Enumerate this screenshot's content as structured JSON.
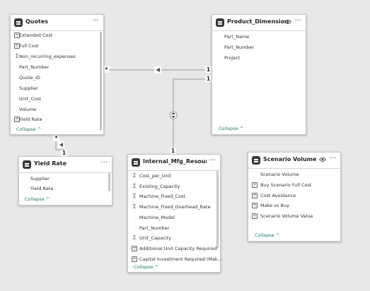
{
  "quotes": {
    "title": "Quotes",
    "fields": [
      {
        "label": "Extended Cost",
        "icon": "calculator-icon"
      },
      {
        "label": "Full Cost",
        "icon": "calculator-icon"
      },
      {
        "label": "Non_recurring_expenses",
        "icon": "sigma-icon"
      },
      {
        "label": "Part_Number",
        "icon": ""
      },
      {
        "label": "Quote_ID",
        "icon": ""
      },
      {
        "label": "Supplier",
        "icon": ""
      },
      {
        "label": "Unit_Cost",
        "icon": ""
      },
      {
        "label": "Volume",
        "icon": ""
      },
      {
        "label": "Yield Rate",
        "icon": "calculator-icon"
      }
    ],
    "collapse": "Collapse ^"
  },
  "product_dimension": {
    "title": "Product_Dimension",
    "fields": [
      {
        "label": "Part_Name"
      },
      {
        "label": "Part_Number"
      },
      {
        "label": "Project"
      }
    ],
    "collapse": "Collapse ^"
  },
  "yield_rate": {
    "title": "Yield Rate",
    "fields": [
      {
        "label": "Supplier"
      },
      {
        "label": "Yield Rate"
      }
    ],
    "collapse": "Collapse ^"
  },
  "internal_mfg": {
    "title": "Internal_Mfg_Resource ...",
    "fields": [
      {
        "label": "Cost_per_Unit",
        "icon": "sigma-icon"
      },
      {
        "label": "Existing_Capacity",
        "icon": "sigma-icon"
      },
      {
        "label": "Machine_Fixed_Cost",
        "icon": "sigma-icon"
      },
      {
        "label": "Machine_Fixed_Overhead_Rate",
        "icon": "sigma-icon"
      },
      {
        "label": "Machine_Model",
        "icon": ""
      },
      {
        "label": "Part_Number",
        "icon": ""
      },
      {
        "label": "Unit_Capacity",
        "icon": "sigma-icon"
      },
      {
        "label": "Additional Unit Capacity Required",
        "icon": "calculator-icon"
      },
      {
        "label": "Capital Investment Required (Mak...",
        "icon": "calculator-icon"
      }
    ],
    "collapse": "Collapse ^"
  },
  "scenario_volume": {
    "title": "Scenario Volume",
    "fields": [
      {
        "label": "Scenario Volume",
        "icon": ""
      },
      {
        "label": "Buy Scenario Full Cost",
        "icon": "calculator-icon"
      },
      {
        "label": "Cost Avoidance",
        "icon": "calculator-icon"
      },
      {
        "label": "Make vs Buy",
        "icon": "calculator-icon"
      },
      {
        "label": "Scenario Volume Value",
        "icon": "calculator-icon"
      }
    ],
    "collapse": "Collapse ^"
  },
  "relationships": {
    "quotes_product": {
      "from_card": "*",
      "to_card": "1"
    },
    "quotes_yield": {
      "from_card": "*",
      "to_card": "1"
    },
    "product_internal": {
      "from_card": "1",
      "to_card": "1"
    }
  },
  "colors": {
    "canvas": "#e8e8e8",
    "card": "#ffffff",
    "line": "#9a9a9a",
    "collapse": "#1e7a6d"
  }
}
